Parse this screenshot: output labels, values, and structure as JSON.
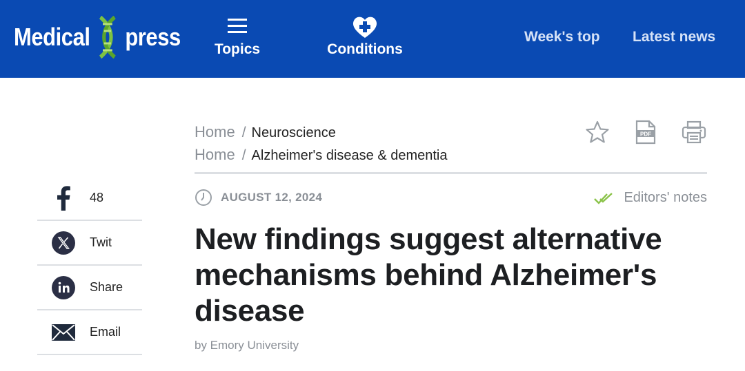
{
  "header": {
    "logo_left": "Medical",
    "logo_right": "press",
    "nav": {
      "topics": "Topics",
      "conditions": "Conditions",
      "weeks_top": "Week's top",
      "latest_news": "Latest news"
    },
    "background_color": "#0a4ab3"
  },
  "breadcrumbs": [
    {
      "home": "Home",
      "separator": "/",
      "category": "Neuroscience"
    },
    {
      "home": "Home",
      "separator": "/",
      "category": "Alzheimer's disease & dementia"
    }
  ],
  "tools": [
    {
      "icon": "star-icon"
    },
    {
      "icon": "pdf-icon"
    },
    {
      "icon": "print-icon"
    }
  ],
  "article": {
    "date": "AUGUST 12, 2024",
    "editors_notes": "Editors' notes",
    "title": "New findings suggest alternative mechanisms behind Alzheimer's disease",
    "byline": "by Emory University"
  },
  "share": [
    {
      "icon": "facebook-icon",
      "label": "48"
    },
    {
      "icon": "x-twitter-icon",
      "label": "Twit"
    },
    {
      "icon": "linkedin-icon",
      "label": "Share"
    },
    {
      "icon": "email-icon",
      "label": "Email"
    }
  ]
}
